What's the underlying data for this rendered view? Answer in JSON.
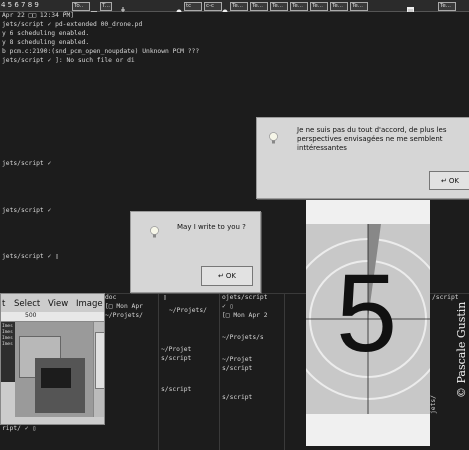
{
  "taskbar": {
    "numbers": "4 5 6 7 8 9",
    "items": [
      "To..",
      "T...",
      "tc",
      "c-c",
      "Te...",
      "Te...",
      "Te...",
      "Te...",
      "Te...",
      "Te...",
      "Te...",
      "Te..."
    ]
  },
  "terminal": {
    "lines": [
      "Apr 22 □□ 12:34 PM]",
      "jets/script ✓ pd-extended 00_drone.pd",
      "y 6 scheduling enabled.",
      "y 8 scheduling enabled.",
      "b pcm.c:2190:(snd_pcm_open_noupdate) Unknown PCM ???",
      "jets/script ✓ ]: No such file or di"
    ],
    "prompts": [
      "jets/script ✓",
      "jets/script ✓",
      "jets/script ✓ ▯"
    ],
    "bottom_prompt": "ript/ ✓ ▯",
    "columns": [
      {
        "lines": [
          "doc",
          "[□ Mon Apr",
          "~/Projets/"
        ]
      },
      {
        "lines": [
          "▯",
          "~/Projets/",
          "",
          "",
          "~/Projet",
          "s/script",
          "",
          "",
          "s/script"
        ]
      },
      {
        "lines": [
          "ojets/script",
          "✓ ▯",
          "[□ Mon Apr 2",
          "",
          "~/Projets/s",
          "",
          "~/Projet",
          "s/script",
          "",
          "s/script"
        ]
      },
      {
        "lines": [
          "/script",
          "",
          "",
          "",
          "",
          "",
          "",
          "",
          "",
          "",
          "",
          "",
          "jets/"
        ]
      }
    ]
  },
  "dialogs": {
    "large": {
      "message": "Je ne suis pas du tout d'accord, de plus les perspectives envisagées ne me semblent inttéressantes",
      "ok_label": "OK"
    },
    "small": {
      "message": "May I write to you ?",
      "ok_label": "OK"
    }
  },
  "editor": {
    "menu": [
      "t",
      "Select",
      "View",
      "Image"
    ],
    "ruler_value": "500",
    "list_items": [
      "Imes",
      "Imes",
      "Imes",
      "Imes"
    ]
  },
  "leader": {
    "number": "5"
  },
  "credit": "© Pascale Gustin"
}
